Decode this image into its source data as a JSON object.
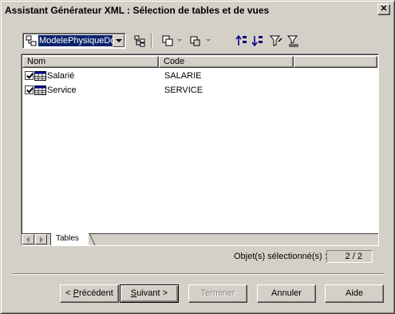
{
  "window": {
    "title": "Assistant Générateur XML : Sélection de tables et de vues",
    "close_glyph": "✕"
  },
  "toolbar": {
    "model_combo_value": "ModelePhysiqueDo",
    "icons": [
      "model-icon",
      "hierarchy-icon",
      "copy-icon",
      "paste-icon",
      "sort-ascending-icon",
      "sort-descending-icon",
      "filter-icon",
      "filter-clear-icon"
    ]
  },
  "list": {
    "columns": [
      "Nom",
      "Code"
    ],
    "rows": [
      {
        "name": "Salarié",
        "code": "SALARIE",
        "checked": true
      },
      {
        "name": "Service",
        "code": "SERVICE",
        "checked": true
      }
    ],
    "tabs": [
      "Tables"
    ]
  },
  "status": {
    "label": "Objet(s) sélectionné(s) :",
    "value": "2 / 2"
  },
  "buttons": {
    "previous_prefix": "< ",
    "previous_mnemonic": "P",
    "previous_rest": "récédent",
    "next_mnemonic": "S",
    "next_rest": "uivant >",
    "finish": "Terminer",
    "cancel": "Annuler",
    "help": "Aide"
  },
  "colors": {
    "window_bg": "#d4d0c8",
    "selection": "#0a246a"
  }
}
